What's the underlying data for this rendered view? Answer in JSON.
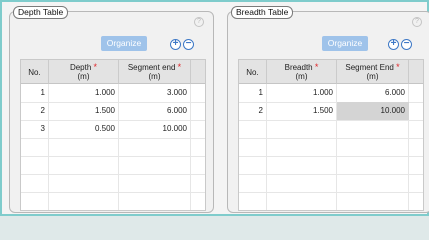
{
  "panels": [
    {
      "title": "Depth Table",
      "help_glyph": "?",
      "organize_label": "Organize",
      "add_glyph": "+",
      "remove_glyph": "−",
      "columns": {
        "no": "No.",
        "c1_name": "Depth",
        "c1_unit": "(m)",
        "c2_name": "Segment end",
        "c2_unit": "(m)",
        "required_mark": "*"
      },
      "rows": [
        {
          "no": "1",
          "v1": "1.000",
          "v2": "3.000"
        },
        {
          "no": "2",
          "v1": "1.500",
          "v2": "6.000"
        },
        {
          "no": "3",
          "v1": "0.500",
          "v2": "10.000"
        }
      ]
    },
    {
      "title": "Breadth Table",
      "help_glyph": "?",
      "organize_label": "Organize",
      "add_glyph": "+",
      "remove_glyph": "−",
      "columns": {
        "no": "No.",
        "c1_name": "Breadth",
        "c1_unit": "(m)",
        "c2_name": "Segment End",
        "c2_unit": "(m)",
        "required_mark": "*"
      },
      "rows": [
        {
          "no": "1",
          "v1": "1.000",
          "v2": "6.000"
        },
        {
          "no": "2",
          "v1": "1.500",
          "v2": "10.000"
        }
      ],
      "selected_cell": {
        "row": 1,
        "col": "v2"
      }
    }
  ],
  "colors": {
    "accent_border": "#7fcccc",
    "organize_button": "#9fc3ea",
    "icon_blue": "#3d78c6",
    "required_star": "#e0262a",
    "selected_cell": "#d4d4d4"
  }
}
